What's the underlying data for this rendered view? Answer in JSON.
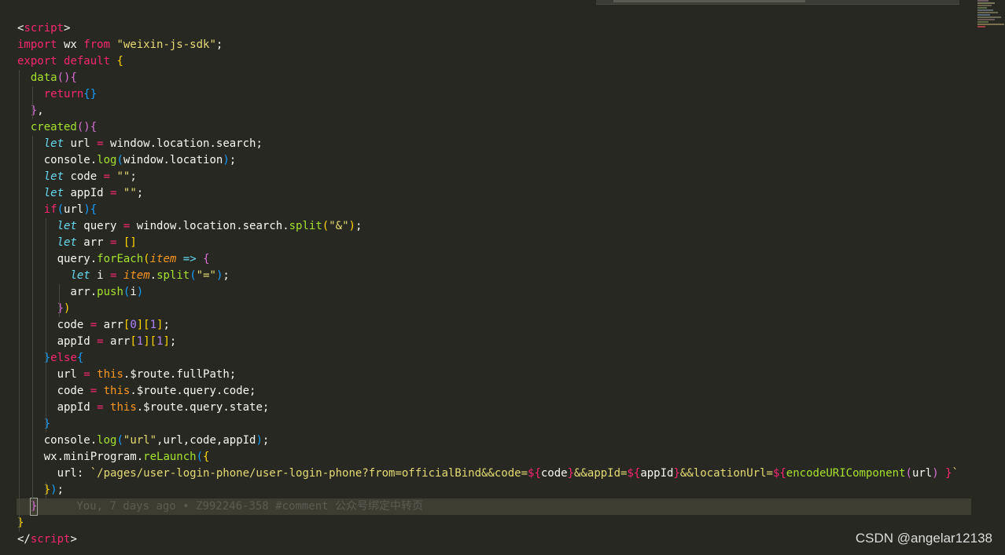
{
  "editor": {
    "language": "vue-script",
    "lines": [
      [
        {
          "t": "<",
          "c": "punc"
        },
        {
          "t": "script",
          "c": "tag"
        },
        {
          "t": ">",
          "c": "punc"
        }
      ],
      [
        {
          "t": "import",
          "c": "kw"
        },
        {
          "t": " wx ",
          "c": "plain"
        },
        {
          "t": "from",
          "c": "kw"
        },
        {
          "t": " ",
          "c": "plain"
        },
        {
          "t": "\"weixin-js-sdk\"",
          "c": "str"
        },
        {
          "t": ";",
          "c": "punc"
        }
      ],
      [
        {
          "t": "export",
          "c": "kw"
        },
        {
          "t": " ",
          "c": "plain"
        },
        {
          "t": "default",
          "c": "kw"
        },
        {
          "t": " ",
          "c": "plain"
        },
        {
          "t": "{",
          "c": "b1"
        }
      ],
      [
        {
          "t": "  ",
          "c": "plain"
        },
        {
          "t": "data",
          "c": "fn"
        },
        {
          "t": "()",
          "c": "b2"
        },
        {
          "t": "{",
          "c": "b2"
        }
      ],
      [
        {
          "t": "    ",
          "c": "plain"
        },
        {
          "t": "return",
          "c": "kw"
        },
        {
          "t": "{}",
          "c": "b3"
        }
      ],
      [
        {
          "t": "  ",
          "c": "plain"
        },
        {
          "t": "}",
          "c": "b2"
        },
        {
          "t": ",",
          "c": "punc"
        }
      ],
      [
        {
          "t": "  ",
          "c": "plain"
        },
        {
          "t": "created",
          "c": "fn"
        },
        {
          "t": "()",
          "c": "b2"
        },
        {
          "t": "{",
          "c": "b2"
        }
      ],
      [
        {
          "t": "    ",
          "c": "plain"
        },
        {
          "t": "let",
          "c": "let"
        },
        {
          "t": " url ",
          "c": "plain"
        },
        {
          "t": "=",
          "c": "op"
        },
        {
          "t": " window.location.search;",
          "c": "plain"
        }
      ],
      [
        {
          "t": "    console.",
          "c": "plain"
        },
        {
          "t": "log",
          "c": "fn"
        },
        {
          "t": "(",
          "c": "b3"
        },
        {
          "t": "window.location",
          "c": "plain"
        },
        {
          "t": ")",
          "c": "b3"
        },
        {
          "t": ";",
          "c": "punc"
        }
      ],
      [
        {
          "t": "    ",
          "c": "plain"
        },
        {
          "t": "let",
          "c": "let"
        },
        {
          "t": " code ",
          "c": "plain"
        },
        {
          "t": "=",
          "c": "op"
        },
        {
          "t": " ",
          "c": "plain"
        },
        {
          "t": "\"\"",
          "c": "str"
        },
        {
          "t": ";",
          "c": "punc"
        }
      ],
      [
        {
          "t": "    ",
          "c": "plain"
        },
        {
          "t": "let",
          "c": "let"
        },
        {
          "t": " appId ",
          "c": "plain"
        },
        {
          "t": "=",
          "c": "op"
        },
        {
          "t": " ",
          "c": "plain"
        },
        {
          "t": "\"\"",
          "c": "str"
        },
        {
          "t": ";",
          "c": "punc"
        }
      ],
      [
        {
          "t": "    ",
          "c": "plain"
        },
        {
          "t": "if",
          "c": "kw"
        },
        {
          "t": "(",
          "c": "b3"
        },
        {
          "t": "url",
          "c": "plain"
        },
        {
          "t": ")",
          "c": "b3"
        },
        {
          "t": "{",
          "c": "b3"
        }
      ],
      [
        {
          "t": "      ",
          "c": "plain"
        },
        {
          "t": "let",
          "c": "let"
        },
        {
          "t": " query ",
          "c": "plain"
        },
        {
          "t": "=",
          "c": "op"
        },
        {
          "t": " window.location.search.",
          "c": "plain"
        },
        {
          "t": "split",
          "c": "fn"
        },
        {
          "t": "(",
          "c": "b1"
        },
        {
          "t": "\"&\"",
          "c": "str"
        },
        {
          "t": ")",
          "c": "b1"
        },
        {
          "t": ";",
          "c": "punc"
        }
      ],
      [
        {
          "t": "      ",
          "c": "plain"
        },
        {
          "t": "let",
          "c": "let"
        },
        {
          "t": " arr ",
          "c": "plain"
        },
        {
          "t": "=",
          "c": "op"
        },
        {
          "t": " ",
          "c": "plain"
        },
        {
          "t": "[]",
          "c": "b1"
        }
      ],
      [
        {
          "t": "      query.",
          "c": "plain"
        },
        {
          "t": "forEach",
          "c": "fn"
        },
        {
          "t": "(",
          "c": "b1"
        },
        {
          "t": "item",
          "c": "param"
        },
        {
          "t": " ",
          "c": "plain"
        },
        {
          "t": "=>",
          "c": "let"
        },
        {
          "t": " ",
          "c": "plain"
        },
        {
          "t": "{",
          "c": "b2"
        }
      ],
      [
        {
          "t": "        ",
          "c": "plain"
        },
        {
          "t": "let",
          "c": "let"
        },
        {
          "t": " i ",
          "c": "plain"
        },
        {
          "t": "=",
          "c": "op"
        },
        {
          "t": " ",
          "c": "plain"
        },
        {
          "t": "item",
          "c": "param"
        },
        {
          "t": ".",
          "c": "plain"
        },
        {
          "t": "split",
          "c": "fn"
        },
        {
          "t": "(",
          "c": "b3"
        },
        {
          "t": "\"=\"",
          "c": "str"
        },
        {
          "t": ")",
          "c": "b3"
        },
        {
          "t": ";",
          "c": "punc"
        }
      ],
      [
        {
          "t": "        arr.",
          "c": "plain"
        },
        {
          "t": "push",
          "c": "fn"
        },
        {
          "t": "(",
          "c": "b3"
        },
        {
          "t": "i",
          "c": "plain"
        },
        {
          "t": ")",
          "c": "b3"
        }
      ],
      [
        {
          "t": "      ",
          "c": "plain"
        },
        {
          "t": "}",
          "c": "b2"
        },
        {
          "t": ")",
          "c": "b1"
        }
      ],
      [
        {
          "t": "      code ",
          "c": "plain"
        },
        {
          "t": "=",
          "c": "op"
        },
        {
          "t": " arr",
          "c": "plain"
        },
        {
          "t": "[",
          "c": "b1"
        },
        {
          "t": "0",
          "c": "num"
        },
        {
          "t": "][",
          "c": "b1"
        },
        {
          "t": "1",
          "c": "num"
        },
        {
          "t": "]",
          "c": "b1"
        },
        {
          "t": ";",
          "c": "punc"
        }
      ],
      [
        {
          "t": "      appId ",
          "c": "plain"
        },
        {
          "t": "=",
          "c": "op"
        },
        {
          "t": " arr",
          "c": "plain"
        },
        {
          "t": "[",
          "c": "b1"
        },
        {
          "t": "1",
          "c": "num"
        },
        {
          "t": "][",
          "c": "b1"
        },
        {
          "t": "1",
          "c": "num"
        },
        {
          "t": "]",
          "c": "b1"
        },
        {
          "t": ";",
          "c": "punc"
        }
      ],
      [
        {
          "t": "    ",
          "c": "plain"
        },
        {
          "t": "}",
          "c": "b3"
        },
        {
          "t": "else",
          "c": "kw"
        },
        {
          "t": "{",
          "c": "b3"
        }
      ],
      [
        {
          "t": "      url ",
          "c": "plain"
        },
        {
          "t": "=",
          "c": "op"
        },
        {
          "t": " ",
          "c": "plain"
        },
        {
          "t": "this",
          "c": "this"
        },
        {
          "t": ".$route.fullPath;",
          "c": "plain"
        }
      ],
      [
        {
          "t": "      code ",
          "c": "plain"
        },
        {
          "t": "=",
          "c": "op"
        },
        {
          "t": " ",
          "c": "plain"
        },
        {
          "t": "this",
          "c": "this"
        },
        {
          "t": ".$route.query.code;",
          "c": "plain"
        }
      ],
      [
        {
          "t": "      appId ",
          "c": "plain"
        },
        {
          "t": "=",
          "c": "op"
        },
        {
          "t": " ",
          "c": "plain"
        },
        {
          "t": "this",
          "c": "this"
        },
        {
          "t": ".$route.query.state;",
          "c": "plain"
        }
      ],
      [
        {
          "t": "    ",
          "c": "plain"
        },
        {
          "t": "}",
          "c": "b3"
        }
      ],
      [
        {
          "t": "    console.",
          "c": "plain"
        },
        {
          "t": "log",
          "c": "fn"
        },
        {
          "t": "(",
          "c": "b3"
        },
        {
          "t": "\"url\"",
          "c": "str"
        },
        {
          "t": ",url,code,appId",
          "c": "plain"
        },
        {
          "t": ")",
          "c": "b3"
        },
        {
          "t": ";",
          "c": "punc"
        }
      ],
      [
        {
          "t": "    wx.miniProgram.",
          "c": "plain"
        },
        {
          "t": "reLaunch",
          "c": "fn"
        },
        {
          "t": "(",
          "c": "b3"
        },
        {
          "t": "{",
          "c": "b1"
        }
      ],
      [
        {
          "t": "      url: ",
          "c": "plain"
        },
        {
          "t": "`/pages/user-login-phone/user-login-phone?from=officialBind&&code=",
          "c": "tmpl"
        },
        {
          "t": "${",
          "c": "kw"
        },
        {
          "t": "code",
          "c": "plain"
        },
        {
          "t": "}",
          "c": "kw"
        },
        {
          "t": "&&appId=",
          "c": "tmpl"
        },
        {
          "t": "${",
          "c": "kw"
        },
        {
          "t": "appId",
          "c": "plain"
        },
        {
          "t": "}",
          "c": "kw"
        },
        {
          "t": "&&locationUrl=",
          "c": "tmpl"
        },
        {
          "t": "${",
          "c": "kw"
        },
        {
          "t": "encodeURIComponent",
          "c": "fn"
        },
        {
          "t": "(",
          "c": "b2"
        },
        {
          "t": "url",
          "c": "plain"
        },
        {
          "t": ")",
          "c": "b2"
        },
        {
          "t": " }",
          "c": "kw"
        },
        {
          "t": "`",
          "c": "tmpl"
        }
      ],
      [
        {
          "t": "    ",
          "c": "plain"
        },
        {
          "t": "}",
          "c": "b1"
        },
        {
          "t": ")",
          "c": "b3"
        },
        {
          "t": ";",
          "c": "punc"
        }
      ],
      [
        {
          "t": "  ",
          "c": "plain"
        },
        {
          "t": "}",
          "c": "b2"
        }
      ],
      [
        {
          "t": "}",
          "c": "b1"
        }
      ],
      [
        {
          "t": "</",
          "c": "punc"
        },
        {
          "t": "script",
          "c": "tag"
        },
        {
          "t": ">",
          "c": "punc"
        }
      ]
    ],
    "current_line_index": 29,
    "blame_annotation": "You, 7 days ago • Z992246-358 #comment 公众号绑定中转页"
  },
  "watermark": "CSDN @angelar12138"
}
